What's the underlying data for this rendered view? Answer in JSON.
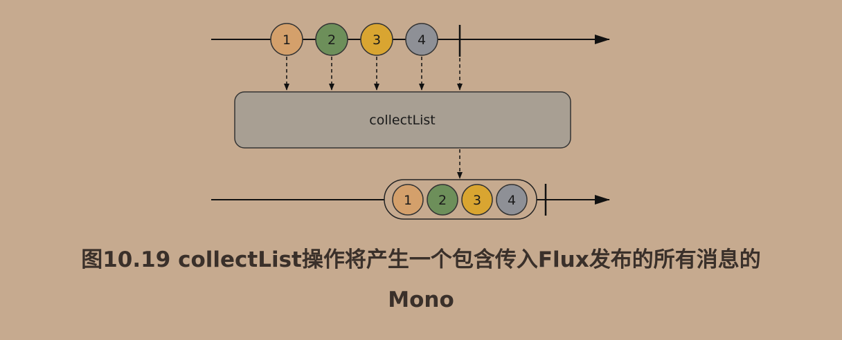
{
  "diagram": {
    "operator_label": "collectList",
    "input_items": [
      {
        "label": "1",
        "color": "#d4a06b"
      },
      {
        "label": "2",
        "color": "#6d8f5a"
      },
      {
        "label": "3",
        "color": "#d9a531"
      },
      {
        "label": "4",
        "color": "#8e9096"
      }
    ],
    "output_items": [
      {
        "label": "1",
        "color": "#d4a06b"
      },
      {
        "label": "2",
        "color": "#6d8f5a"
      },
      {
        "label": "3",
        "color": "#d9a531"
      },
      {
        "label": "4",
        "color": "#8e9096"
      }
    ],
    "colors": {
      "background": "#c6aa8f",
      "operator_box": "#a89f93",
      "line": "#111111",
      "caption_text": "#3a302a"
    }
  },
  "caption": {
    "line1": "图10.19 collectList操作将产生一个包含传入Flux发布的所有消息的",
    "line2": "Mono"
  }
}
